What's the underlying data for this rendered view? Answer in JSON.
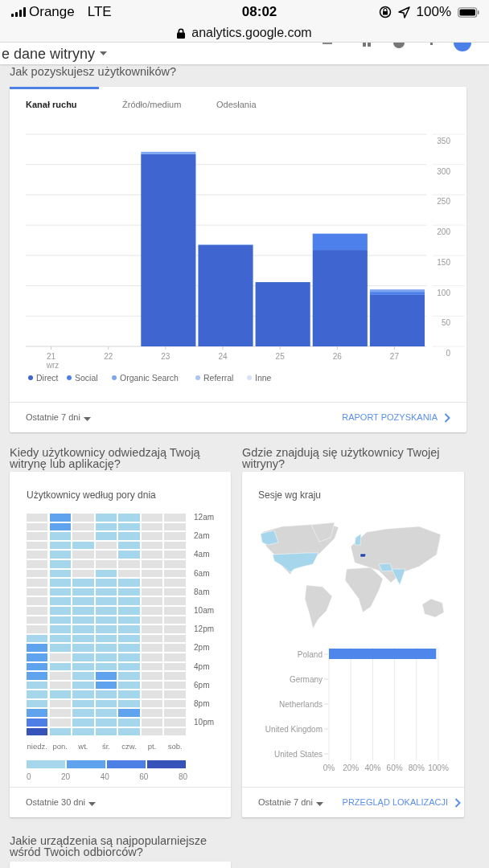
{
  "status_bar": {
    "carrier": "Orange",
    "network": "LTE",
    "time": "08:02",
    "battery": "100%"
  },
  "browser": {
    "url": "analytics.google.com"
  },
  "app_bar": {
    "title": "e dane witryny"
  },
  "acquisition": {
    "heading": "Jak pozyskujesz użytkowników?",
    "tabs": [
      {
        "label": "Kanał ruchu",
        "selected": true
      },
      {
        "label": "Źródło/medium",
        "selected": false
      },
      {
        "label": "Odesłania",
        "selected": false
      }
    ],
    "chart_data": {
      "type": "bar",
      "stacked": true,
      "grid": true,
      "categories": [
        "21\nwrz",
        "22",
        "23",
        "24",
        "25",
        "26",
        "27"
      ],
      "ylim": [
        0,
        350
      ],
      "yticks": [
        0,
        50,
        100,
        150,
        200,
        250,
        300,
        350
      ],
      "series": [
        {
          "name": "Direct",
          "color": "#3f66d0",
          "values": [
            0,
            0,
            317,
            167,
            106,
            159,
            85
          ]
        },
        {
          "name": "Social",
          "color": "#4d80ea",
          "values": [
            0,
            0,
            0,
            0,
            0,
            27,
            5
          ]
        },
        {
          "name": "Organic Search",
          "color": "#7ea6f0",
          "values": [
            0,
            0,
            4,
            1,
            0,
            0,
            4
          ]
        },
        {
          "name": "Referral",
          "color": "#a9c4f5",
          "values": [
            0,
            0,
            0,
            0,
            0,
            0,
            0
          ]
        },
        {
          "name": "Inne",
          "color": "#d6e1fb",
          "values": [
            0,
            0,
            0,
            0,
            0,
            0,
            0
          ]
        }
      ]
    },
    "date_range": "Ostatnie 7 dni",
    "link": "RAPORT POZYSKANIA"
  },
  "time_of_day": {
    "heading": "Kiedy użytkownicy odwiedzają Twoją witrynę lub aplikację?",
    "title": "Użytkownicy według pory dnia",
    "rows": [
      {
        "label": "12am",
        "cells": [
          {
            "color": "#e2e2e2"
          },
          {
            "color": "#5fa2ee"
          },
          {
            "color": "#e2e2e2"
          },
          {
            "color": "#a6d6ec"
          },
          {
            "color": "#a6d6ec"
          },
          {
            "color": "#e2e2e2"
          },
          {
            "color": "#e2e2e2"
          }
        ]
      },
      {
        "cells": [
          {
            "color": "#e2e2e2"
          },
          {
            "color": "#5fa2ee"
          },
          {
            "color": "#e2e2e2"
          },
          {
            "color": "#a6d6ec"
          },
          {
            "color": "#a6d6ec"
          },
          {
            "color": "#e2e2e2"
          },
          {
            "color": "#e2e2e2"
          }
        ]
      },
      {
        "label": "2am",
        "cells": [
          {
            "color": "#e2e2e2"
          },
          {
            "color": "#a6d6ec"
          },
          {
            "color": "#e2e2e2"
          },
          {
            "color": "#a6d6ec"
          },
          {
            "color": "#a6d6ec"
          },
          {
            "color": "#e2e2e2"
          },
          {
            "color": "#e2e2e2"
          }
        ]
      },
      {
        "cells": [
          {
            "color": "#e2e2e2"
          },
          {
            "color": "#a6d6ec"
          },
          {
            "color": "#a6d6ec"
          },
          {
            "color": "#e2e2e2"
          },
          {
            "color": "#a6d6ec"
          },
          {
            "color": "#e2e2e2"
          },
          {
            "color": "#e2e2e2"
          }
        ]
      },
      {
        "label": "4am",
        "cells": [
          {
            "color": "#e2e2e2"
          },
          {
            "color": "#a6d6ec"
          },
          {
            "color": "#e2e2e2"
          },
          {
            "color": "#e2e2e2"
          },
          {
            "color": "#a6d6ec"
          },
          {
            "color": "#e2e2e2"
          },
          {
            "color": "#e2e2e2"
          }
        ]
      },
      {
        "cells": [
          {
            "color": "#e2e2e2"
          },
          {
            "color": "#a6d6ec"
          },
          {
            "color": "#e2e2e2"
          },
          {
            "color": "#e2e2e2"
          },
          {
            "color": "#e2e2e2"
          },
          {
            "color": "#e2e2e2"
          },
          {
            "color": "#e2e2e2"
          }
        ]
      },
      {
        "label": "6am",
        "cells": [
          {
            "color": "#e2e2e2"
          },
          {
            "color": "#a6d6ec"
          },
          {
            "color": "#e2e2e2"
          },
          {
            "color": "#a6d6ec"
          },
          {
            "color": "#e2e2e2"
          },
          {
            "color": "#e2e2e2"
          },
          {
            "color": "#e2e2e2"
          }
        ]
      },
      {
        "cells": [
          {
            "color": "#e2e2e2"
          },
          {
            "color": "#a6d6ec"
          },
          {
            "color": "#a6d6ec"
          },
          {
            "color": "#a6d6ec"
          },
          {
            "color": "#a6d6ec"
          },
          {
            "color": "#e2e2e2"
          },
          {
            "color": "#e2e2e2"
          }
        ]
      },
      {
        "label": "8am",
        "cells": [
          {
            "color": "#e2e2e2"
          },
          {
            "color": "#a6d6ec"
          },
          {
            "color": "#a6d6ec"
          },
          {
            "color": "#a6d6ec"
          },
          {
            "color": "#a6d6ec"
          },
          {
            "color": "#e2e2e2"
          },
          {
            "color": "#e2e2e2"
          }
        ]
      },
      {
        "cells": [
          {
            "color": "#e2e2e2"
          },
          {
            "color": "#a6d6ec"
          },
          {
            "color": "#a6d6ec"
          },
          {
            "color": "#a6d6ec"
          },
          {
            "color": "#a6d6ec"
          },
          {
            "color": "#e2e2e2"
          },
          {
            "color": "#e2e2e2"
          }
        ]
      },
      {
        "label": "10am",
        "cells": [
          {
            "color": "#e2e2e2"
          },
          {
            "color": "#a6d6ec"
          },
          {
            "color": "#a6d6ec"
          },
          {
            "color": "#a6d6ec"
          },
          {
            "color": "#a6d6ec"
          },
          {
            "color": "#e2e2e2"
          },
          {
            "color": "#e2e2e2"
          }
        ]
      },
      {
        "cells": [
          {
            "color": "#e2e2e2"
          },
          {
            "color": "#a6d6ec"
          },
          {
            "color": "#a6d6ec"
          },
          {
            "color": "#a6d6ec"
          },
          {
            "color": "#a6d6ec"
          },
          {
            "color": "#e2e2e2"
          },
          {
            "color": "#e2e2e2"
          }
        ]
      },
      {
        "label": "12pm",
        "cells": [
          {
            "color": "#e2e2e2"
          },
          {
            "color": "#a6d6ec"
          },
          {
            "color": "#a6d6ec"
          },
          {
            "color": "#a6d6ec"
          },
          {
            "color": "#a6d6ec"
          },
          {
            "color": "#e2e2e2"
          },
          {
            "color": "#e2e2e2"
          }
        ]
      },
      {
        "cells": [
          {
            "color": "#a6d6ec"
          },
          {
            "color": "#a6d6ec"
          },
          {
            "color": "#a6d6ec"
          },
          {
            "color": "#a6d6ec"
          },
          {
            "color": "#a6d6ec"
          },
          {
            "color": "#e2e2e2"
          },
          {
            "color": "#e2e2e2"
          }
        ]
      },
      {
        "label": "2pm",
        "cells": [
          {
            "color": "#5fa2ee"
          },
          {
            "color": "#a6d6ec"
          },
          {
            "color": "#a6d6ec"
          },
          {
            "color": "#a6d6ec"
          },
          {
            "color": "#a6d6ec"
          },
          {
            "color": "#e2e2e2"
          },
          {
            "color": "#e2e2e2"
          }
        ]
      },
      {
        "cells": [
          {
            "color": "#5fa2ee"
          },
          {
            "color": "#e2e2e2"
          },
          {
            "color": "#a6d6ec"
          },
          {
            "color": "#a6d6ec"
          },
          {
            "color": "#a6d6ec"
          },
          {
            "color": "#e2e2e2"
          },
          {
            "color": "#e2e2e2"
          }
        ]
      },
      {
        "label": "4pm",
        "cells": [
          {
            "color": "#5fa2ee"
          },
          {
            "color": "#a6d6ec"
          },
          {
            "color": "#a6d6ec"
          },
          {
            "color": "#a6d6ec"
          },
          {
            "color": "#a6d6ec"
          },
          {
            "color": "#e2e2e2"
          },
          {
            "color": "#e2e2e2"
          }
        ]
      },
      {
        "cells": [
          {
            "color": "#5fa2ee"
          },
          {
            "color": "#e2e2e2"
          },
          {
            "color": "#a6d6ec"
          },
          {
            "color": "#5fa2ee"
          },
          {
            "color": "#a6d6ec"
          },
          {
            "color": "#e2e2e2"
          },
          {
            "color": "#e2e2e2"
          }
        ]
      },
      {
        "label": "6pm",
        "cells": [
          {
            "color": "#a6d6ec"
          },
          {
            "color": "#e2e2e2"
          },
          {
            "color": "#a6d6ec"
          },
          {
            "color": "#5fa2ee"
          },
          {
            "color": "#a6d6ec"
          },
          {
            "color": "#e2e2e2"
          },
          {
            "color": "#e2e2e2"
          }
        ]
      },
      {
        "cells": [
          {
            "color": "#a6d6ec"
          },
          {
            "color": "#a6d6ec"
          },
          {
            "color": "#a6d6ec"
          },
          {
            "color": "#a6d6ec"
          },
          {
            "color": "#a6d6ec"
          },
          {
            "color": "#e2e2e2"
          },
          {
            "color": "#e2e2e2"
          }
        ]
      },
      {
        "label": "8pm",
        "cells": [
          {
            "color": "#a6d6ec"
          },
          {
            "color": "#e2e2e2"
          },
          {
            "color": "#a6d6ec"
          },
          {
            "color": "#a6d6ec"
          },
          {
            "color": "#a6d6ec"
          },
          {
            "color": "#e2e2e2"
          },
          {
            "color": "#e2e2e2"
          }
        ]
      },
      {
        "cells": [
          {
            "color": "#5fa2ee"
          },
          {
            "color": "#e2e2e2"
          },
          {
            "color": "#a6d6ec"
          },
          {
            "color": "#a6d6ec"
          },
          {
            "color": "#5fa2ee"
          },
          {
            "color": "#e2e2e2"
          },
          {
            "color": "#e2e2e2"
          }
        ]
      },
      {
        "label": "10pm",
        "cells": [
          {
            "color": "#4d7fe7"
          },
          {
            "color": "#e2e2e2"
          },
          {
            "color": "#a6d6ec"
          },
          {
            "color": "#a6d6ec"
          },
          {
            "color": "#a6d6ec"
          },
          {
            "color": "#e2e2e2"
          },
          {
            "color": "#e2e2e2"
          }
        ]
      },
      {
        "cells": [
          {
            "color": "#3553b9"
          },
          {
            "color": "#a6d6ec"
          },
          {
            "color": "#a6d6ec"
          },
          {
            "color": "#a6d6ec"
          },
          {
            "color": "#a6d6ec"
          },
          {
            "color": "#e2e2e2"
          },
          {
            "color": "#e2e2e2"
          }
        ]
      }
    ],
    "days": [
      "niedz.",
      "pon.",
      "wt.",
      "śr.",
      "czw.",
      "pt.",
      "sob."
    ],
    "legend": [
      {
        "color": "#a6d6ec"
      },
      {
        "color": "#5fa2ee"
      },
      {
        "color": "#4d7fe7"
      },
      {
        "color": "#3553b9"
      }
    ],
    "scale_labels": [
      "0",
      "20",
      "40",
      "60",
      "80"
    ],
    "date_range": "Ostatnie 30 dni"
  },
  "location": {
    "heading": "Gdzie znajdują się użytkownicy Twojej witryny?",
    "title": "Sesje wg kraju",
    "chart_data": {
      "type": "bar",
      "orientation": "horizontal",
      "grid": true,
      "categories": [
        "Poland",
        "Germany",
        "Netherlands",
        "United Kingdom",
        "United States"
      ],
      "series": [
        {
          "color": "#4f86ec",
          "values": [
            0.98,
            0,
            0,
            0,
            0
          ]
        }
      ],
      "xlim": [
        0,
        1
      ],
      "xticks": [
        {
          "value": 0,
          "label": "0%"
        },
        {
          "value": 0.2,
          "label": "20%"
        },
        {
          "value": 0.4,
          "label": "40%"
        },
        {
          "value": 0.6,
          "label": "60%"
        },
        {
          "value": 0.8,
          "label": "80%"
        },
        {
          "value": 1,
          "label": "100%"
        }
      ]
    },
    "date_range": "Ostatnie 7 dni",
    "link": "PRZEGLĄD LOKALIZACJI"
  },
  "devices": {
    "heading": "Jakie urządzenia są najpopularniejsze wśród Twoich odbiorców?"
  }
}
